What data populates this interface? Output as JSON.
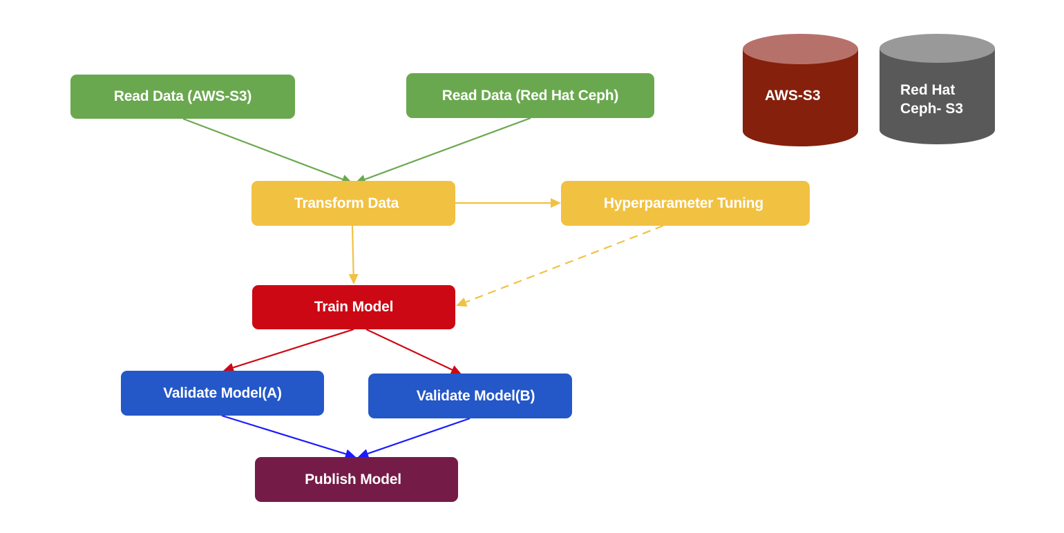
{
  "colors": {
    "read": "#6aa84f",
    "transform": "#f1c142",
    "train": "#cc0814",
    "validate": "#2457c8",
    "publish": "#741b47",
    "arrow_green": "#6aa84f",
    "arrow_yellow": "#f1c142",
    "arrow_red": "#cc0814",
    "arrow_blue": "#1a1aff",
    "aws_cyl_body": "#85200c",
    "aws_cyl_top": "#b6726a",
    "ceph_cyl_body": "#595959",
    "ceph_cyl_top": "#999999"
  },
  "nodes": {
    "read_aws": {
      "label": "Read Data (AWS-S3)"
    },
    "read_ceph": {
      "label": "Read Data (Red Hat Ceph)"
    },
    "transform": {
      "label": "Transform Data"
    },
    "hyper": {
      "label": "Hyperparameter Tuning"
    },
    "train": {
      "label": "Train Model"
    },
    "validate_a": {
      "label": "Validate Model(A)"
    },
    "validate_b": {
      "label": "Validate Model(B)"
    },
    "publish": {
      "label": "Publish Model"
    }
  },
  "storage": {
    "aws": {
      "label": "AWS-S3"
    },
    "ceph": {
      "line1": "Red Hat",
      "line2": "Ceph- S3"
    }
  },
  "edges": [
    {
      "from": "read_aws",
      "to": "transform",
      "style": "solid",
      "color": "arrow_green"
    },
    {
      "from": "read_ceph",
      "to": "transform",
      "style": "solid",
      "color": "arrow_green"
    },
    {
      "from": "transform",
      "to": "hyper",
      "style": "solid",
      "color": "arrow_yellow"
    },
    {
      "from": "transform",
      "to": "train",
      "style": "solid",
      "color": "arrow_yellow"
    },
    {
      "from": "hyper",
      "to": "train",
      "style": "dashed",
      "color": "arrow_yellow"
    },
    {
      "from": "train",
      "to": "validate_a",
      "style": "solid",
      "color": "arrow_red"
    },
    {
      "from": "train",
      "to": "validate_b",
      "style": "solid",
      "color": "arrow_red"
    },
    {
      "from": "validate_a",
      "to": "publish",
      "style": "solid",
      "color": "arrow_blue"
    },
    {
      "from": "validate_b",
      "to": "publish",
      "style": "solid",
      "color": "arrow_blue"
    }
  ]
}
